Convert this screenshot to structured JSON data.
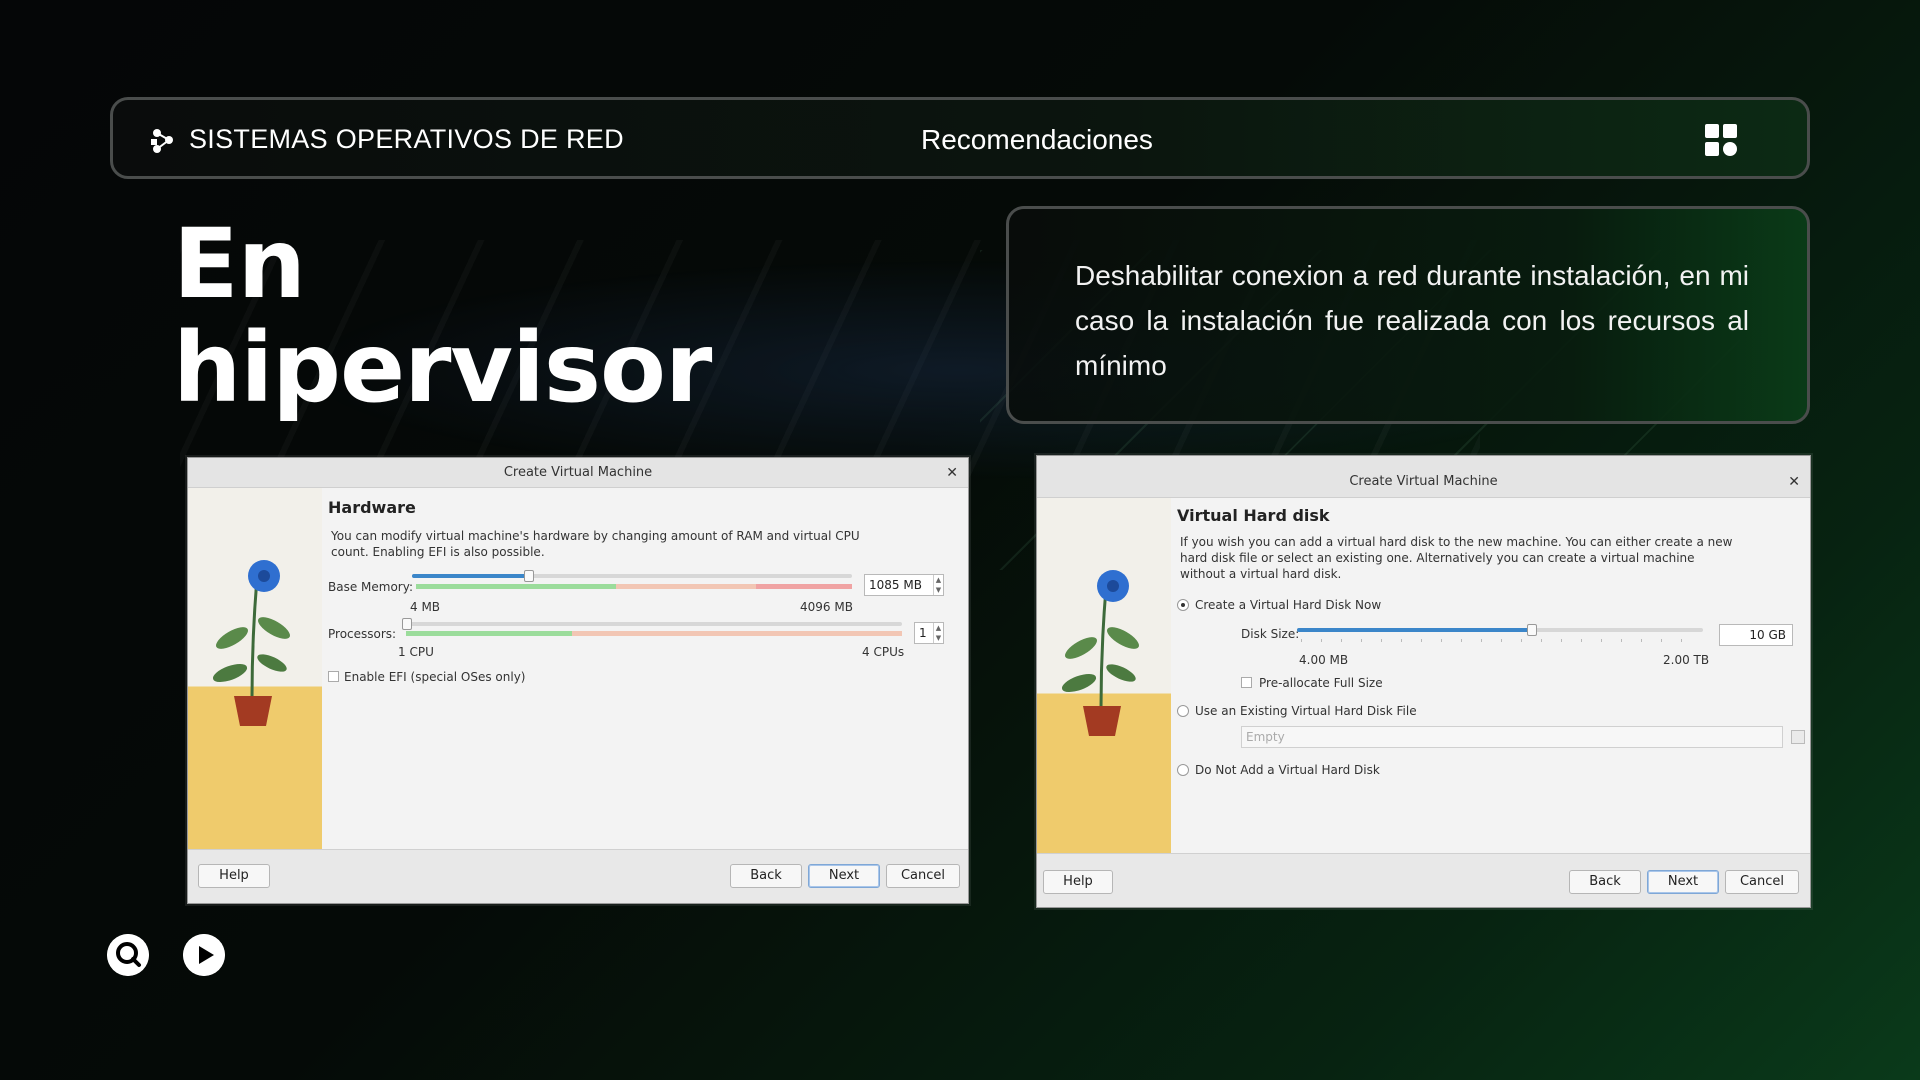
{
  "header": {
    "title": "SISTEMAS OPERATIVOS DE RED",
    "section": "Recomendaciones",
    "logo_icon": "network-nodes-icon",
    "menu_icon": "grid-icon"
  },
  "main": {
    "title_line1": "En",
    "title_line2": "hipervisor",
    "note": "Deshabilitar conexion a red durante instalación, en mi caso la instalación fue realizada con los recursos al mínimo"
  },
  "dialog_hardware": {
    "window_title": "Create Virtual Machine",
    "heading": "Hardware",
    "description": "You can modify virtual machine's hardware by changing amount of RAM and virtual CPU count. Enabling EFI is also possible.",
    "memory_label": "Base Memory:",
    "memory_value": "1085 MB",
    "memory_min": "4 MB",
    "memory_max": "4096 MB",
    "memory_fraction": 0.265,
    "processors_label": "Processors:",
    "processors_value": "1",
    "processors_min": "1 CPU",
    "processors_max": "4 CPUs",
    "processors_fraction": 0.0,
    "efi_label": "Enable EFI (special OSes only)",
    "efi_checked": false,
    "buttons": {
      "help": "Help",
      "back": "Back",
      "next": "Next",
      "cancel": "Cancel"
    }
  },
  "dialog_disk": {
    "window_title": "Create Virtual Machine",
    "heading": "Virtual Hard disk",
    "description": "If you wish you can add a virtual hard disk to the new machine. You can either create a new hard disk file or select an existing one. Alternatively you can create a virtual machine without a virtual hard disk.",
    "option_create": "Create a Virtual Hard Disk Now",
    "disk_size_label": "Disk Size:",
    "disk_size_value": "10 GB",
    "disk_min": "4.00 MB",
    "disk_max": "2.00 TB",
    "disk_fraction": 0.58,
    "preallocate_label": "Pre-allocate Full Size",
    "option_existing": "Use an Existing Virtual Hard Disk File",
    "existing_placeholder": "Empty",
    "option_none": "Do Not Add a Virtual Hard Disk",
    "selected_option": "create",
    "buttons": {
      "help": "Help",
      "back": "Back",
      "next": "Next",
      "cancel": "Cancel"
    }
  },
  "bottom_icons": [
    "search-icon",
    "play-icon"
  ],
  "colors": {
    "accent_green": "#0a3a1a",
    "slider_blue": "#3b86c9",
    "sidebar_yellow": "#efcb6c"
  }
}
